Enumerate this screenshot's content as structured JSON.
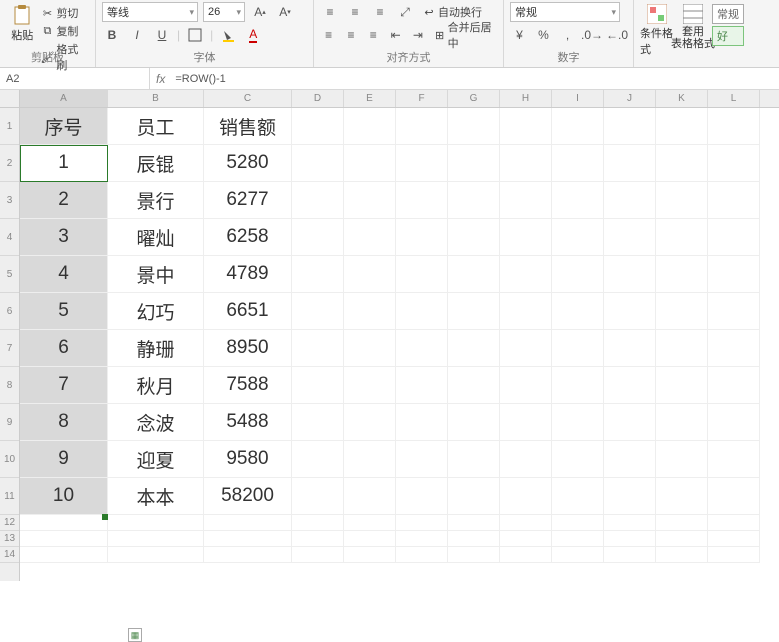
{
  "ribbon": {
    "clipboard": {
      "paste": "粘贴",
      "cut": "剪切",
      "copy": "复制",
      "painter": "格式刷",
      "label": "剪贴板"
    },
    "font": {
      "name": "等线",
      "size": "26",
      "label": "字体"
    },
    "align": {
      "wrap": "自动换行",
      "merge": "合并后居中",
      "label": "对齐方式"
    },
    "number": {
      "format": "常规",
      "label": "数字"
    },
    "styles": {
      "cond": "条件格式",
      "cell": "套用\n表格格式",
      "good": "好",
      "normal": "常规"
    }
  },
  "formula_bar": {
    "cell_ref": "A2",
    "formula": "=ROW()-1"
  },
  "columns": [
    "A",
    "B",
    "C",
    "D",
    "E",
    "F",
    "G",
    "H",
    "I",
    "J",
    "K",
    "L"
  ],
  "row_labels": [
    "1",
    "2",
    "3",
    "4",
    "5",
    "6",
    "7",
    "8",
    "9",
    "10",
    "11",
    "12",
    "13",
    "14"
  ],
  "headers": {
    "seq": "序号",
    "emp": "员工",
    "sales": "销售额"
  },
  "chart_data": {
    "type": "table",
    "columns": [
      "序号",
      "员工",
      "销售额"
    ],
    "rows": [
      [
        1,
        "辰锟",
        5280
      ],
      [
        2,
        "景行",
        6277
      ],
      [
        3,
        "曜灿",
        6258
      ],
      [
        4,
        "景中",
        4789
      ],
      [
        5,
        "幻巧",
        6651
      ],
      [
        6,
        "静珊",
        8950
      ],
      [
        7,
        "秋月",
        7588
      ],
      [
        8,
        "念波",
        5488
      ],
      [
        9,
        "迎夏",
        9580
      ],
      [
        10,
        "本本",
        58200
      ]
    ]
  }
}
